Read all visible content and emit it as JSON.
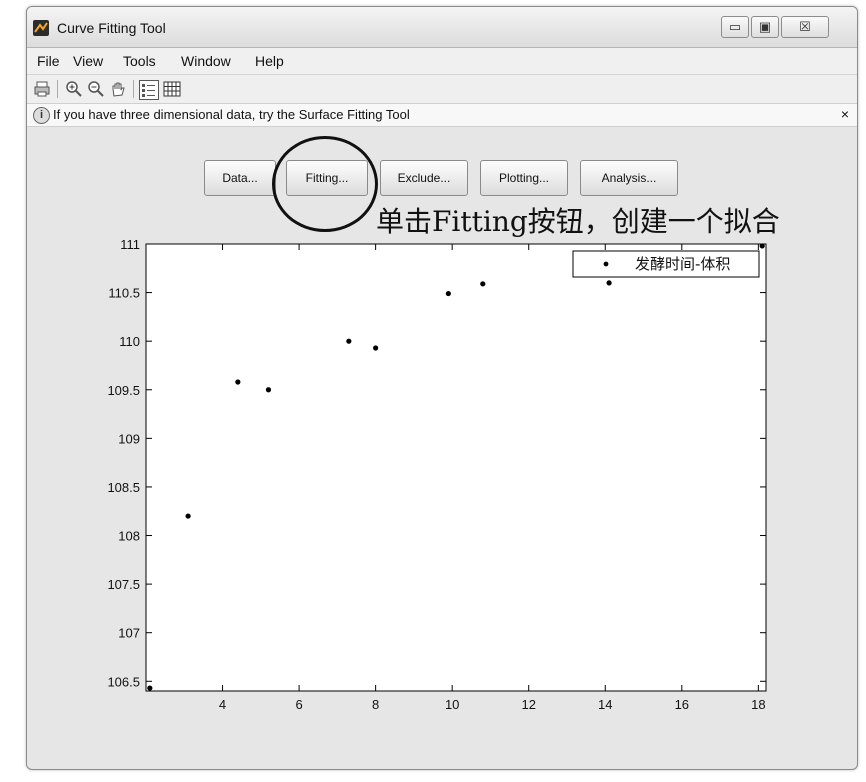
{
  "window": {
    "title": "Curve Fitting Tool",
    "controls": {
      "minimize": "▭",
      "maximize": "▣",
      "close": "☒"
    }
  },
  "menu": [
    "File",
    "View",
    "Tools",
    "Window",
    "Help"
  ],
  "toolbar": {
    "icons": [
      "print-icon",
      "zoom-in-icon",
      "zoom-out-icon",
      "pan-hand-icon",
      "legend-toggle-icon",
      "grid-toggle-icon"
    ]
  },
  "infobar": {
    "message": "If you have three dimensional data, try the Surface Fitting Tool",
    "close": "×"
  },
  "buttons": [
    "Data...",
    "Fitting...",
    "Exclude...",
    "Plotting...",
    "Analysis..."
  ],
  "annotation": "单击Fitting按钮，创建一个拟合",
  "chart_data": {
    "type": "scatter",
    "xlim": [
      2,
      18.2
    ],
    "ylim": [
      106.4,
      111
    ],
    "x_ticks": [
      4,
      6,
      8,
      10,
      12,
      14,
      16,
      18
    ],
    "y_ticks": [
      106.5,
      107,
      107.5,
      108,
      108.5,
      109,
      109.5,
      110,
      110.5,
      111
    ],
    "x_tick_labels": [
      "4",
      "6",
      "8",
      "10",
      "12",
      "14",
      "16",
      "18"
    ],
    "y_tick_labels": [
      "106.5",
      "107",
      "107.5",
      "108",
      "108.5",
      "109",
      "109.5",
      "110",
      "110.5",
      "111"
    ],
    "series": [
      {
        "name": "发酵时间-体积",
        "color": "#000000",
        "points": [
          [
            2.1,
            106.43
          ],
          [
            3.1,
            108.2
          ],
          [
            4.4,
            109.58
          ],
          [
            5.2,
            109.5
          ],
          [
            7.3,
            110.0
          ],
          [
            8.0,
            109.93
          ],
          [
            9.9,
            110.49
          ],
          [
            10.8,
            110.59
          ],
          [
            14.1,
            110.6
          ],
          [
            18.1,
            110.98
          ]
        ]
      }
    ],
    "grid": false,
    "legend_position": "top-right"
  }
}
